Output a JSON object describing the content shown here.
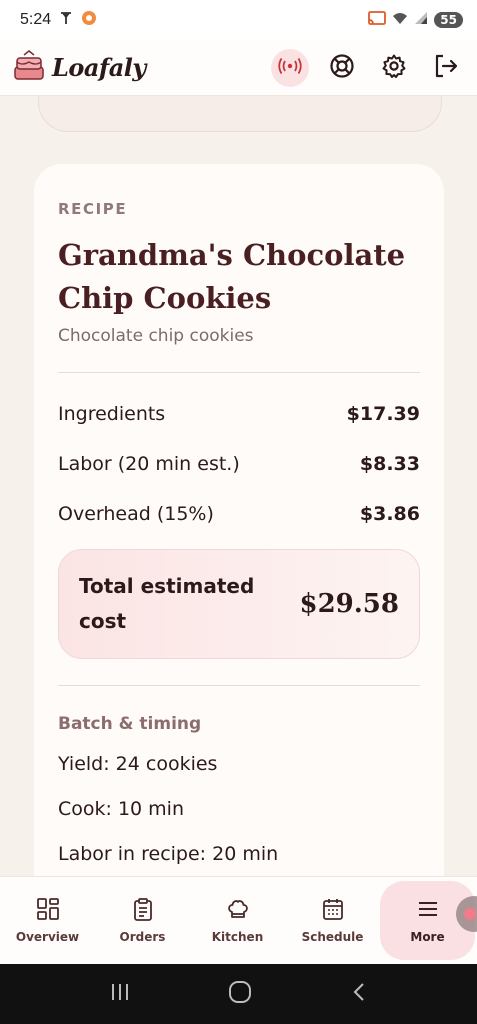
{
  "status_bar": {
    "time": "5:24",
    "battery": "55"
  },
  "header": {
    "brand_name": "Loafaly"
  },
  "recipe": {
    "eyebrow": "RECIPE",
    "title_line1": "Grandma's Chocolate",
    "title_line2": "Chip Cookies",
    "subtitle": "Chocolate chip cookies"
  },
  "costs": [
    {
      "label": "Ingredients",
      "amount": "$17.39"
    },
    {
      "label": "Labor (20 min est.)",
      "amount": "$8.33"
    },
    {
      "label": "Overhead (15%)",
      "amount": "$3.86"
    }
  ],
  "total": {
    "label": "Total estimated cost",
    "amount": "$29.58"
  },
  "batch": {
    "title": "Batch & timing",
    "items": [
      "Yield: 24 cookies",
      "Cook: 10 min",
      "Labor in recipe: 20 min"
    ]
  },
  "bottom_nav": [
    {
      "label": "Overview",
      "icon": "grid-icon"
    },
    {
      "label": "Orders",
      "icon": "clipboard-icon"
    },
    {
      "label": "Kitchen",
      "icon": "chef-hat-icon"
    },
    {
      "label": "Schedule",
      "icon": "calendar-icon"
    },
    {
      "label": "More",
      "icon": "menu-icon",
      "active": true
    }
  ],
  "colors": {
    "accent": "#fbe0e3",
    "title": "#4a1f21",
    "live_indicator": "#c8343c"
  }
}
